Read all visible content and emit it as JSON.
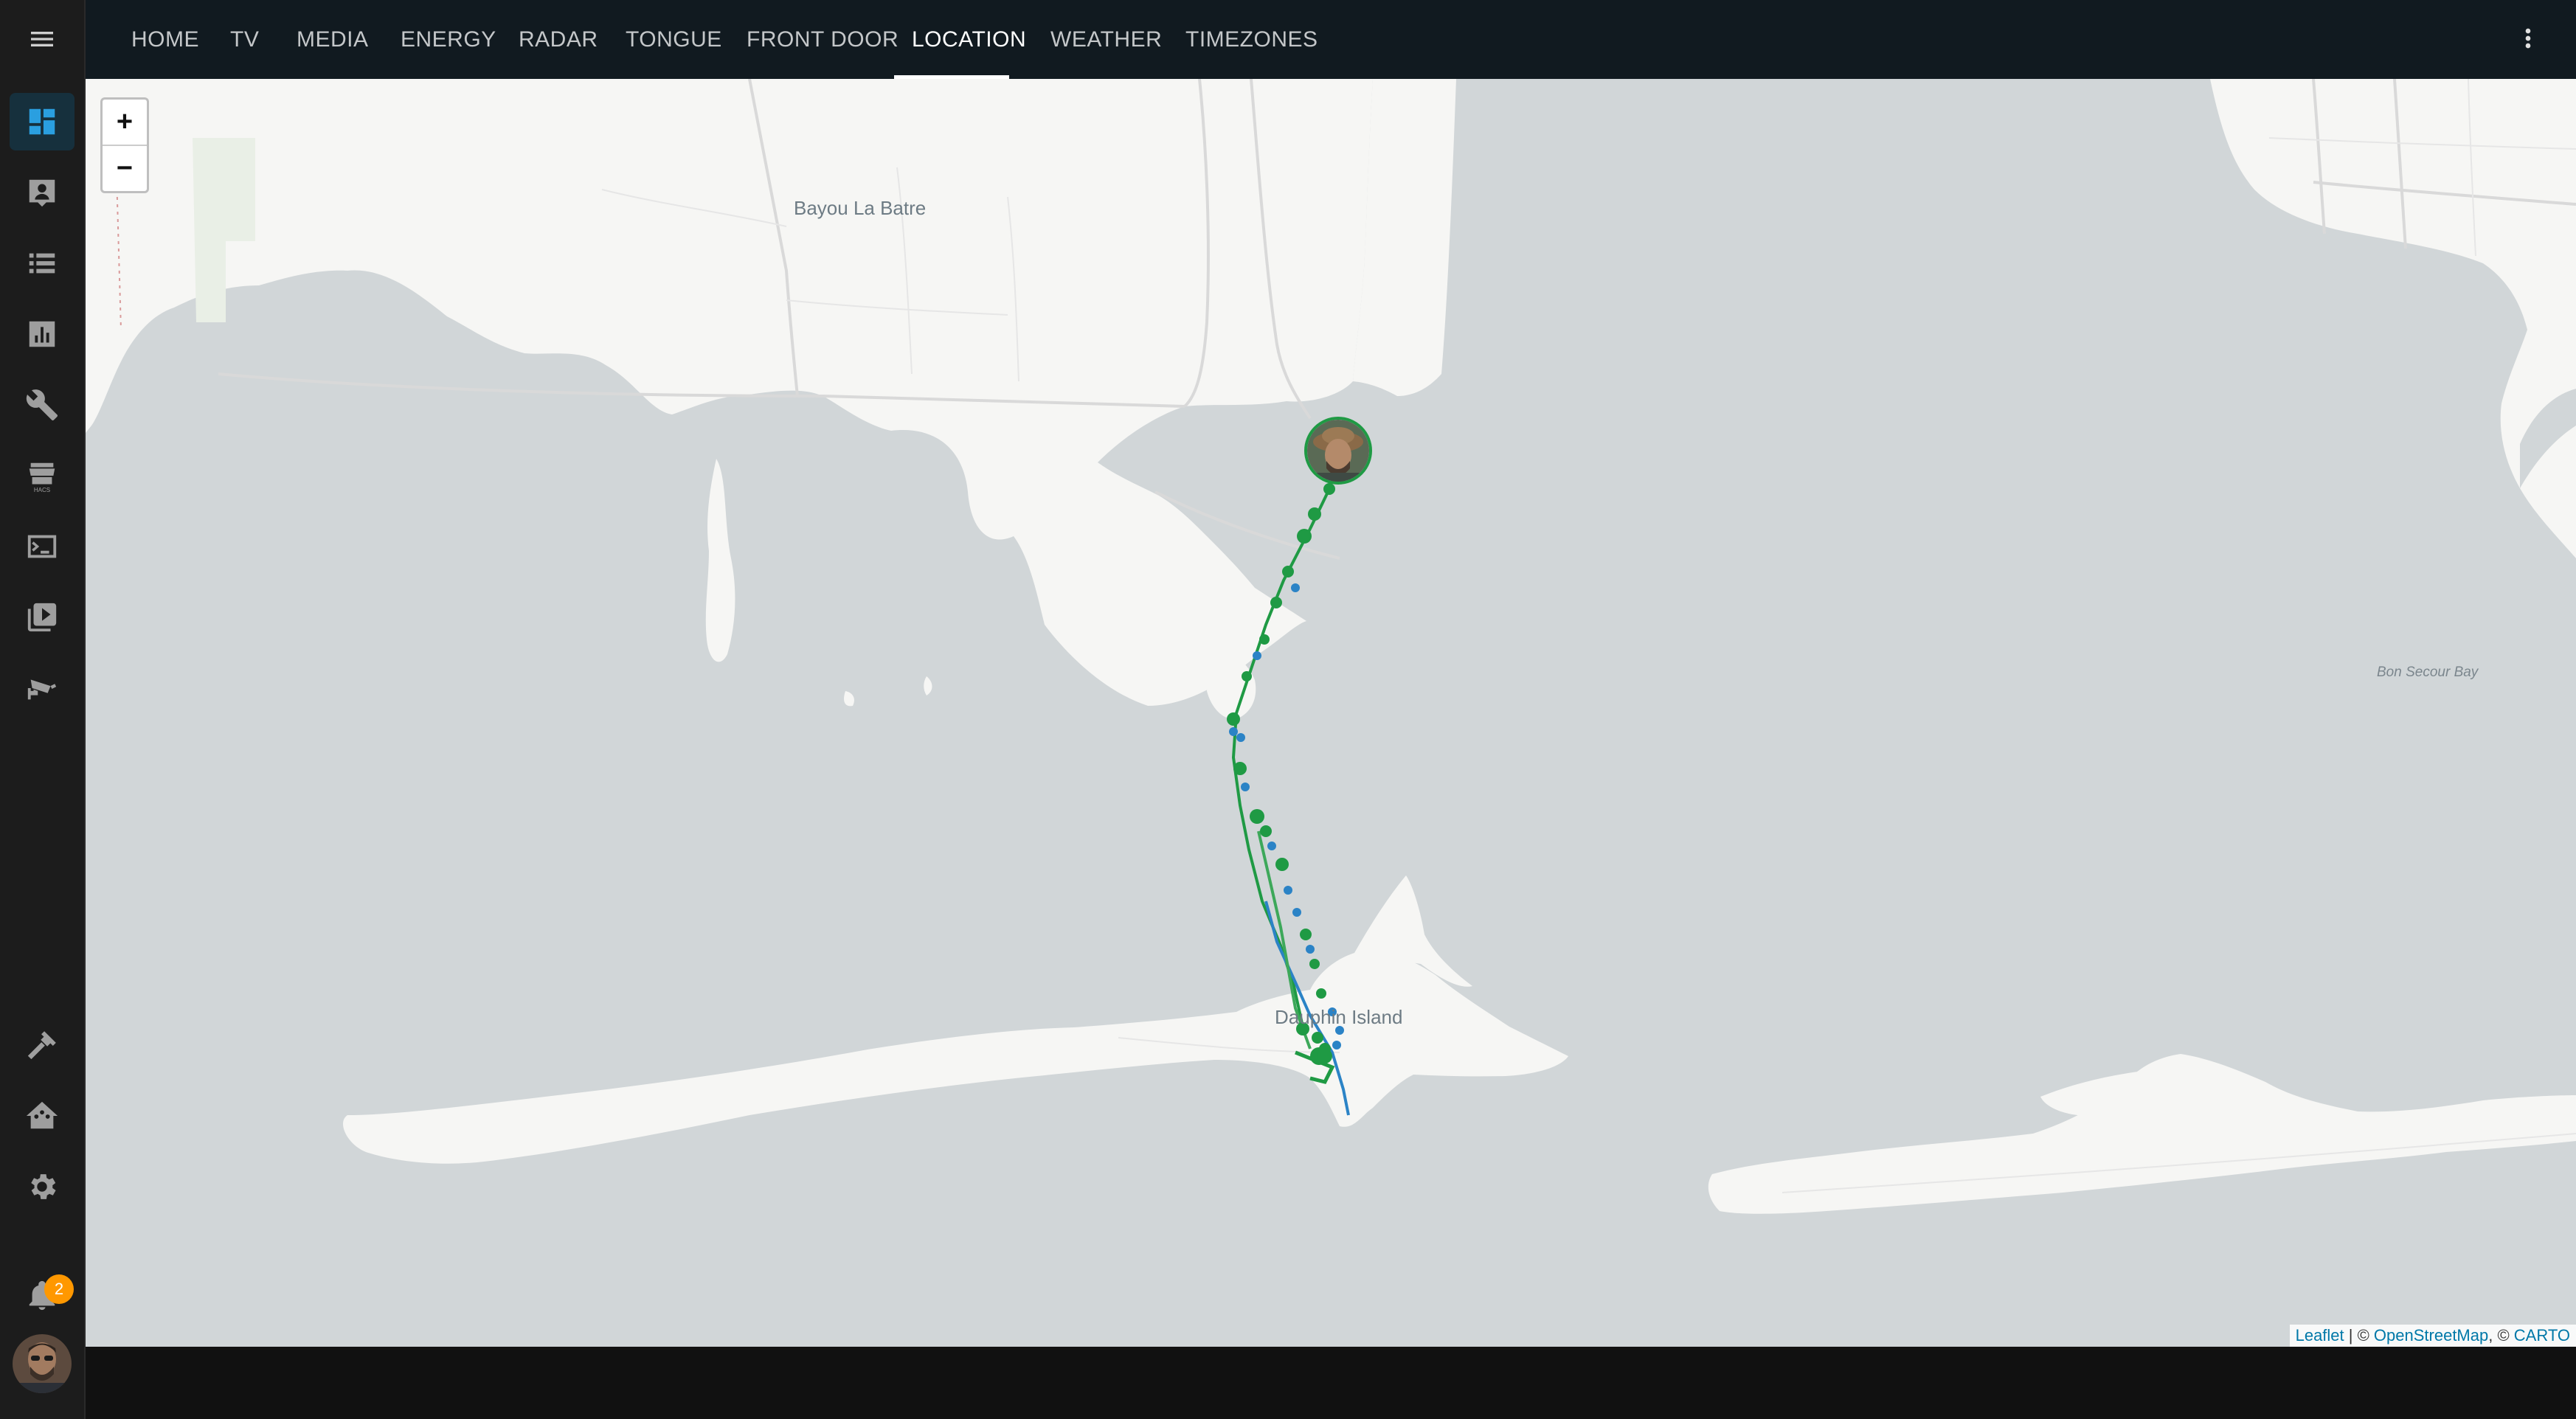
{
  "nav": {
    "menu_icon": "menu-icon",
    "tabs": [
      {
        "label": "HOME"
      },
      {
        "label": "TV"
      },
      {
        "label": "MEDIA"
      },
      {
        "label": "ENERGY"
      },
      {
        "label": "RADAR"
      },
      {
        "label": "TONGUE"
      },
      {
        "label": "FRONT DOOR"
      },
      {
        "label": "LOCATION",
        "active": true
      },
      {
        "label": "WEATHER"
      },
      {
        "label": "TIMEZONES"
      }
    ],
    "overflow_icon": "more-vert-icon"
  },
  "sidebar": {
    "items": [
      {
        "icon": "dashboard-icon",
        "active": true
      },
      {
        "icon": "map-person-icon"
      },
      {
        "icon": "logbook-icon"
      },
      {
        "icon": "history-chart-icon"
      },
      {
        "icon": "wrench-icon"
      },
      {
        "icon": "hacs-store-icon",
        "caption": "HACS"
      },
      {
        "icon": "terminal-icon"
      },
      {
        "icon": "media-library-icon"
      },
      {
        "icon": "cctv-camera-icon"
      }
    ],
    "bottom_items": [
      {
        "icon": "hammer-icon"
      },
      {
        "icon": "home-assistant-icon"
      },
      {
        "icon": "settings-icon"
      }
    ],
    "notifications": {
      "icon": "bell-icon",
      "count": "2"
    },
    "user_icon": "user-avatar"
  },
  "map": {
    "labels": {
      "bayou": "Bayou La Batre",
      "island": "Dauphin Island",
      "bay": "Bon Secour Bay"
    },
    "zoom_in": "+",
    "zoom_out": "−",
    "attribution": {
      "leaflet": "Leaflet",
      "sep1": " | © ",
      "osm": "OpenStreetMap",
      "sep2": ", © ",
      "carto": "CARTO"
    },
    "colors": {
      "water": "#d1d6d8",
      "land": "#f6f6f4",
      "track_green": "#1f9a44",
      "track_blue": "#2b83c6"
    },
    "marker": "person-location-marker"
  }
}
